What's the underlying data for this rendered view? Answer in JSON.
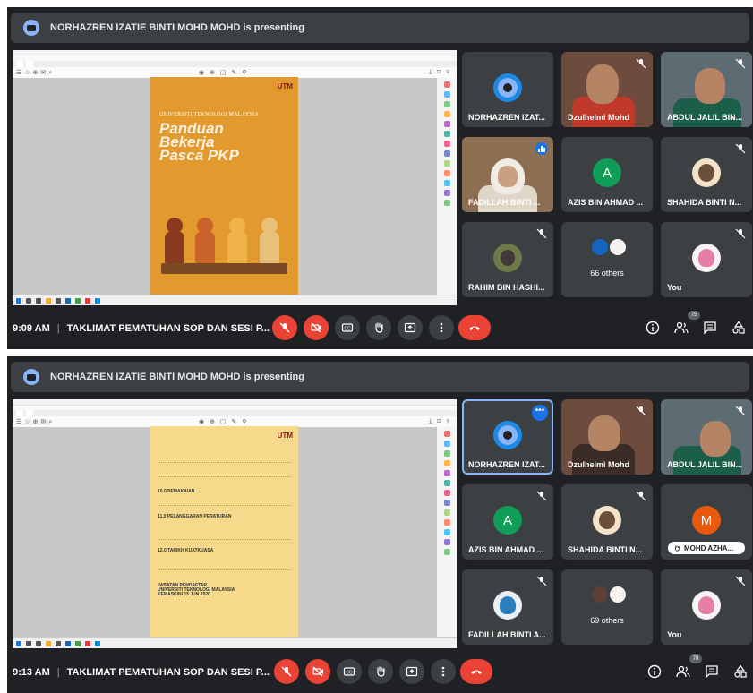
{
  "panels": [
    {
      "banner": "NORHAZREN IZATIE BINTI MOHD MOHD is presenting",
      "time": "9:09 AM",
      "meeting": "TAKLIMAT PEMATUHAN SOP DAN SESI P...",
      "participant_count": "75",
      "others": "66 others",
      "tiles": [
        "NORHAZREN IZAT...",
        "Dzulhelmi Mohd",
        "ABDUL JALIL BIN...",
        "FADILLAH BINTI ...",
        "AZIS BIN AHMAD ...",
        "SHAHIDA BINTI N...",
        "RAHIM BIN HASHI...",
        "You"
      ],
      "avatar_letter": "A",
      "doc": {
        "logo": "UTM",
        "university": "UNIVERSITI TEKNOLOGI MALAYSIA",
        "title_lines": [
          "Panduan",
          "Bekerja",
          "Pasca PKP"
        ]
      }
    },
    {
      "banner": "NORHAZREN IZATIE BINTI MOHD MOHD is presenting",
      "time": "9:13 AM",
      "meeting": "TAKLIMAT PEMATUHAN SOP DAN SESI P...",
      "participant_count": "78",
      "others": "69 others",
      "tiles": [
        "NORHAZREN IZAT...",
        "Dzulhelmi Mohd",
        "ABDUL JALIL BIN...",
        "AZIS BIN AHMAD ...",
        "SHAHIDA BINTI N...",
        "MOHD AZHA...",
        "FADILLAH BINTI A...",
        "You"
      ],
      "avatar_letters": [
        "A",
        "M"
      ],
      "doc": {
        "logo": "UTM",
        "headings": [
          "10.0 PEMAKAIAN",
          "11.0 PELANGGARAN PERATURAN",
          "12.0 TARIKH KUATKUASA"
        ],
        "sign": [
          "JABATAN PENDAFTAR",
          "UNIVERSITI TEKNOLOGI MALAYSIA",
          "KEMASKINI 15 JUN 2020"
        ]
      }
    }
  ],
  "colors": {
    "meet_bg": "#202124",
    "tile_bg": "#3c4043",
    "danger": "#ea4335",
    "accent": "#8ab4f8",
    "cover": "#e29a2f"
  }
}
